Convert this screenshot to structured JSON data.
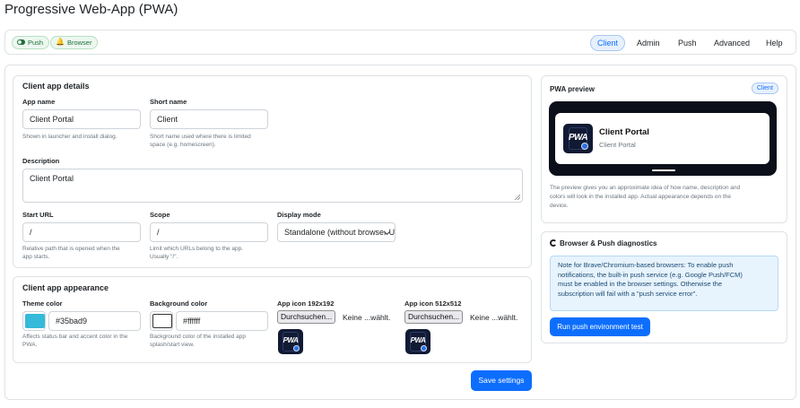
{
  "page": {
    "title": "Progressive Web-App (PWA)"
  },
  "status_badges": [
    {
      "label": "Push",
      "icon": "toggle-icon"
    },
    {
      "label": "Browser",
      "icon": "bell-icon"
    }
  ],
  "tabs": [
    {
      "label": "Client",
      "active": true
    },
    {
      "label": "Admin",
      "active": false
    },
    {
      "label": "Push",
      "active": false
    },
    {
      "label": "Advanced",
      "active": false
    },
    {
      "label": "Help",
      "active": false
    }
  ],
  "details": {
    "title": "Client app details",
    "app_name": {
      "label": "App name",
      "value": "Client Portal",
      "help": "Shown in launcher and install dialog."
    },
    "short_name": {
      "label": "Short name",
      "value": "Client",
      "help_lines": [
        "Short name used where there is limited",
        "space (e.g. homescreen)."
      ]
    },
    "description": {
      "label": "Description",
      "value": "Client Portal"
    },
    "start_url": {
      "label": "Start URL",
      "value": "/",
      "help_lines": [
        "Relative path that is opened when the",
        "app starts."
      ]
    },
    "scope": {
      "label": "Scope",
      "value": "/",
      "help_lines": [
        "Limit which URLs belong to the app.",
        "Usually \"/\"."
      ]
    },
    "display_mode": {
      "label": "Display mode",
      "value": "Standalone (without browser UI)"
    }
  },
  "appearance": {
    "title": "Client app appearance",
    "theme_color": {
      "label": "Theme color",
      "value": "#35bad9",
      "help_lines": [
        "Affects status bar and accent color in the",
        "PWA."
      ]
    },
    "background_color": {
      "label": "Background color",
      "value": "#ffffff",
      "help_lines": [
        "Background color of the installed app",
        "splash/start view."
      ]
    },
    "icon_192": {
      "label": "App icon 192x192",
      "button": "Durchsuchen...",
      "status": "Keine ...wählt.",
      "icon_text": "PWA"
    },
    "icon_512": {
      "label": "App icon 512x512",
      "button": "Durchsuchen...",
      "status": "Keine ...wählt.",
      "icon_text": "PWA"
    }
  },
  "save_button": "Save settings",
  "preview": {
    "title": "PWA preview",
    "badge": "Client",
    "app_name": "Client Portal",
    "short_name": "Client Portal",
    "icon_text": "PWA",
    "help_lines": [
      "The preview gives you an approximate idea of how name, description and",
      "colors will look in the installed app. Actual appearance depends on the",
      "device."
    ]
  },
  "diagnostics": {
    "title": "Browser & Push diagnostics",
    "note_lines": [
      "Note for Brave/Chromium-based browsers: To enable push",
      "notifications, the built-in push service (e.g. Google Push/FCM)",
      "must be enabled in the browser settings. Otherwise the",
      "subscription will fail with a \"push service error\"."
    ],
    "button": "Run push environment test"
  },
  "colors": {
    "accent": "#0d6efd",
    "theme": "#35bad9",
    "background": "#ffffff",
    "badge_green": "#1f6f3a"
  }
}
